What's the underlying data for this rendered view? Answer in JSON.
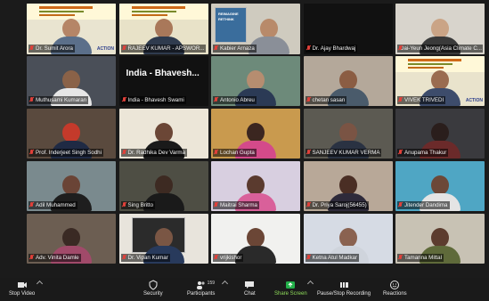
{
  "conference_banner": "INTERNATIONAL TOWN-HALL ON CLIMATE CHANGE MITIGATION AND ADAPTATION (ICCMA-2021)",
  "screen_text": {
    "bhavesh_tile_text": "India - Bhavesh...",
    "reimagine_text": "REIMAGINE RETHINK"
  },
  "participants": [
    {
      "name": "Dr. Sumit Arora",
      "tag": "ACTION"
    },
    {
      "name": "RAJEEV KUMAR - APSWOR..."
    },
    {
      "name": "Kabier Arnaza"
    },
    {
      "name": "Dr. Ajay Bhardwaj"
    },
    {
      "name": "Dai-Yeun Jeong(Asia Climate C..."
    },
    {
      "name": "Muthusami Kumaran"
    },
    {
      "name": "India - Bhavesh Swami"
    },
    {
      "name": "Antonio Abreu"
    },
    {
      "name": "chetan sasan"
    },
    {
      "name": "VIVEK TRIVEDI",
      "tag": "ACTION"
    },
    {
      "name": "Prof. Inderjeet Singh Sodhi"
    },
    {
      "name": "Dr. Radhika Dev Varma"
    },
    {
      "name": "Lochan Gupta"
    },
    {
      "name": "SANJEEV KUMAR VERMA"
    },
    {
      "name": "Anupama Thakur"
    },
    {
      "name": "Adil Muhammed"
    },
    {
      "name": "Sing Britto"
    },
    {
      "name": "Maitrai Sharma"
    },
    {
      "name": "Dr. Priya Saroj(56455)"
    },
    {
      "name": "Jitender Dandima"
    },
    {
      "name": "Adv. Vinita Damle"
    },
    {
      "name": "Dr. Vipan Kumar"
    },
    {
      "name": "vrijkishor"
    },
    {
      "name": "Ketna Atul Madkar"
    },
    {
      "name": "Tamanna Mittal"
    }
  ],
  "toolbar": {
    "stop_video": "Stop Video",
    "security": "Security",
    "participants": "Participants",
    "participant_count": "159",
    "chat": "Chat",
    "share_screen": "Share Screen",
    "record": "Pause/Stop Recording",
    "reactions": "Reactions"
  },
  "colors": {
    "accent_green": "#9ee24a",
    "share_green": "#23b04a",
    "muted_red": "#e0413a"
  }
}
